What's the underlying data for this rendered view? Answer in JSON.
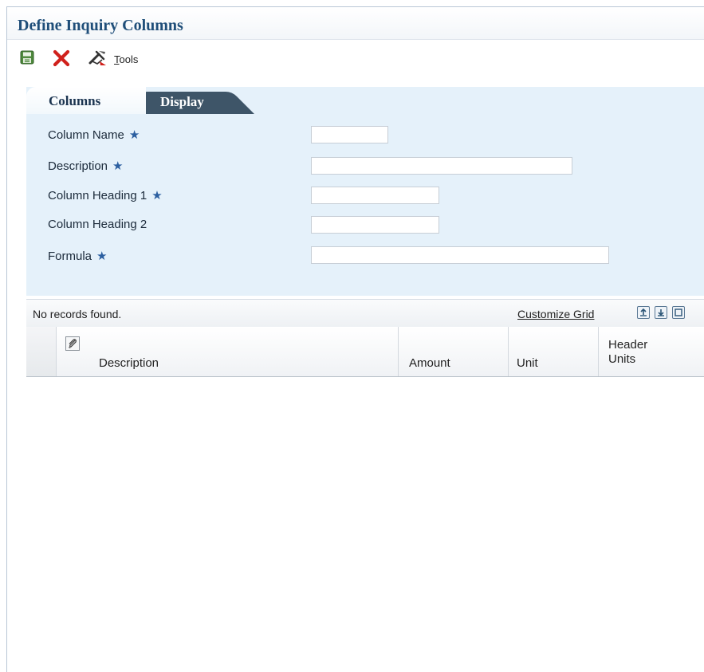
{
  "window": {
    "title": "Define Inquiry Columns"
  },
  "toolbar": {
    "save_icon": "floppy-disk-icon",
    "close_icon": "close-x-icon",
    "tools_icon": "tools-icon",
    "tools_hotkey": "T",
    "tools_rest": "ools"
  },
  "tabs": [
    {
      "label": "Columns",
      "active": true
    },
    {
      "label": "Display",
      "active": false
    }
  ],
  "form": {
    "fields": [
      {
        "label": "Column Name",
        "required": true,
        "value": ""
      },
      {
        "label": "Description",
        "required": true,
        "value": ""
      },
      {
        "label": "Column Heading 1",
        "required": true,
        "value": ""
      },
      {
        "label": "Column Heading 2",
        "required": false,
        "value": ""
      },
      {
        "label": "Formula",
        "required": true,
        "value": ""
      }
    ],
    "required_mark": "★"
  },
  "grid": {
    "status": "No records found.",
    "customize_label": "Customize Grid",
    "export_icon": "export-icon",
    "import_icon": "import-icon",
    "maximize_icon": "maximize-icon",
    "attachment_icon": "attachment-icon",
    "columns": [
      {
        "label": "Description"
      },
      {
        "label": "Amount"
      },
      {
        "label": "Unit"
      },
      {
        "label_line1": "Header",
        "label_line2": "Units"
      }
    ],
    "rows": []
  },
  "colors": {
    "title": "#1f4e79",
    "panel": "#e5f1fa",
    "required_star": "#2b5fa0",
    "inactive_tab": "#3e5568"
  }
}
